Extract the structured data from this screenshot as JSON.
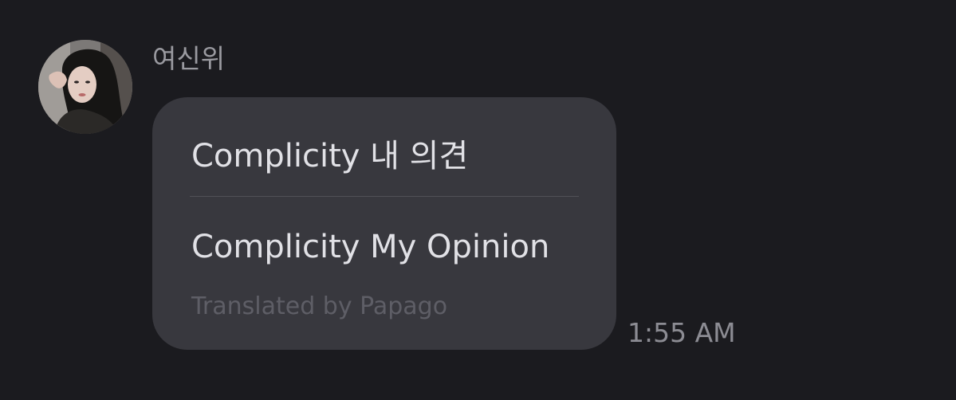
{
  "message": {
    "sender_name": "여신위",
    "original_text": "Complicity 내 의견",
    "translated_text": "Complicity My Opinion",
    "translation_credit": "Translated by Papago",
    "timestamp": "1:55 AM"
  },
  "avatar": {
    "icon": "profile-photo"
  },
  "colors": {
    "background": "#1b1b1f",
    "bubble": "#38383e",
    "text_primary": "#e1e1e6",
    "text_muted": "#5e5e66",
    "name_color": "#9a9aa0",
    "timestamp_color": "#8c8c93"
  }
}
